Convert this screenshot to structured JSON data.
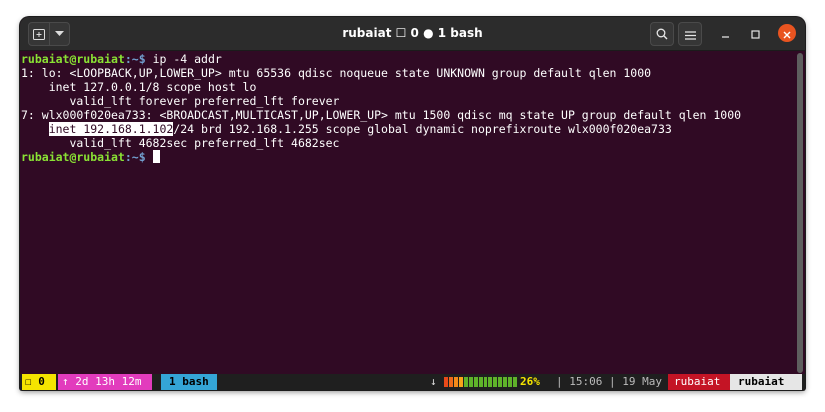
{
  "window": {
    "title": "rubaiat ☐ 0 ● 1 bash",
    "icons": [
      "new-tab-icon",
      "dropdown-icon",
      "search-icon",
      "menu-icon",
      "minimize-icon",
      "maximize-icon",
      "close-icon"
    ]
  },
  "terminal": {
    "prompt_user": "rubaiat@rubaiat",
    "prompt_path": ":~$",
    "command": " ip -4 addr",
    "lines": [
      "1: lo: <LOOPBACK,UP,LOWER_UP> mtu 65536 qdisc noqueue state UNKNOWN group default qlen 1000",
      "    inet 127.0.0.1/8 scope host lo",
      "       valid_lft forever preferred_lft forever",
      "7: wlx000f020ea733: <BROADCAST,MULTICAST,UP,LOWER_UP> mtu 1500 qdisc mq state UP group default qlen 1000"
    ],
    "highlight_prefix": "    ",
    "highlight_text": "inet 192.168.1.102",
    "highlight_rest": "/24 brd 192.168.1.255 scope global dynamic noprefixroute wlx000f020ea733",
    "last_line": "       valid_lft 4682sec preferred_lft 4682sec"
  },
  "statusbar": {
    "workspace": "☐ 0",
    "uptime": "↑ 2d 13h 12m",
    "window": "1 bash",
    "arrow": "↓",
    "battery_percent": "26%",
    "battery_level": 0.26,
    "time": "| 15:06 | 19 May",
    "user_red": "rubaiat",
    "user_white": "rubaiat"
  },
  "colors": {
    "background": "#300a24",
    "prompt_user": "#8ae234",
    "prompt_path": "#729fcf",
    "close": "#e95420"
  }
}
